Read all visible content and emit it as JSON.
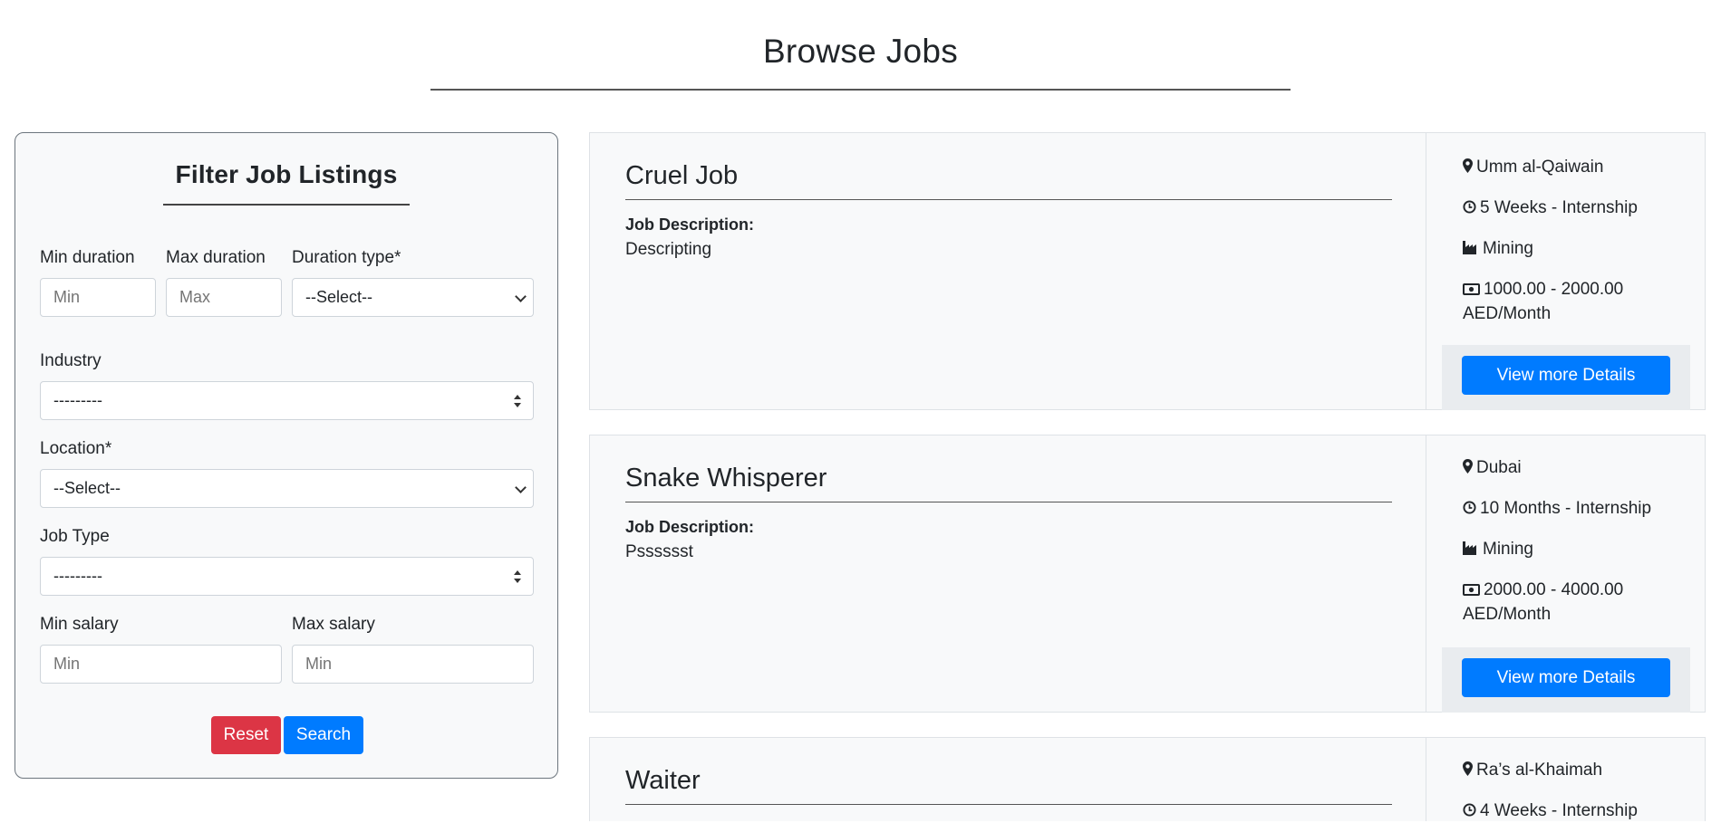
{
  "page": {
    "title": "Browse Jobs"
  },
  "filter": {
    "title": "Filter Job Listings",
    "min_duration": {
      "label": "Min duration",
      "placeholder": "Min"
    },
    "max_duration": {
      "label": "Max duration",
      "placeholder": "Max"
    },
    "duration_type": {
      "label": "Duration type*",
      "value": "--Select--"
    },
    "industry": {
      "label": "Industry",
      "value": "---------"
    },
    "location": {
      "label": "Location*",
      "value": "--Select--"
    },
    "job_type": {
      "label": "Job Type",
      "value": "---------"
    },
    "min_salary": {
      "label": "Min salary",
      "placeholder": "Min"
    },
    "max_salary": {
      "label": "Max salary",
      "placeholder": "Min"
    },
    "reset_label": "Reset",
    "search_label": "Search"
  },
  "jobs": [
    {
      "title": "Cruel Job",
      "desc_label": "Job Description:",
      "description": "Descripting",
      "location": "Umm al-Qaiwain",
      "duration": "5 Weeks - Internship",
      "industry": "Mining",
      "salary_line1": "1000.00 - 2000.00",
      "salary_line2": "AED/Month",
      "button": "View more Details"
    },
    {
      "title": "Snake Whisperer",
      "desc_label": "Job Description:",
      "description": "Psssssst",
      "location": "Dubai",
      "duration": "10 Months - Internship",
      "industry": "Mining",
      "salary_line1": "2000.00 - 4000.00",
      "salary_line2": "AED/Month",
      "button": "View more Details"
    },
    {
      "title": "Waiter",
      "location": "Ra’s al-Khaimah",
      "duration": "4 Weeks - Internship"
    }
  ],
  "colors": {
    "primary": "#007bff",
    "danger": "#dc3545",
    "panel_bg": "#f8f9fa"
  },
  "icons": [
    "map-marker-icon",
    "clock-icon",
    "industry-icon",
    "money-icon"
  ]
}
